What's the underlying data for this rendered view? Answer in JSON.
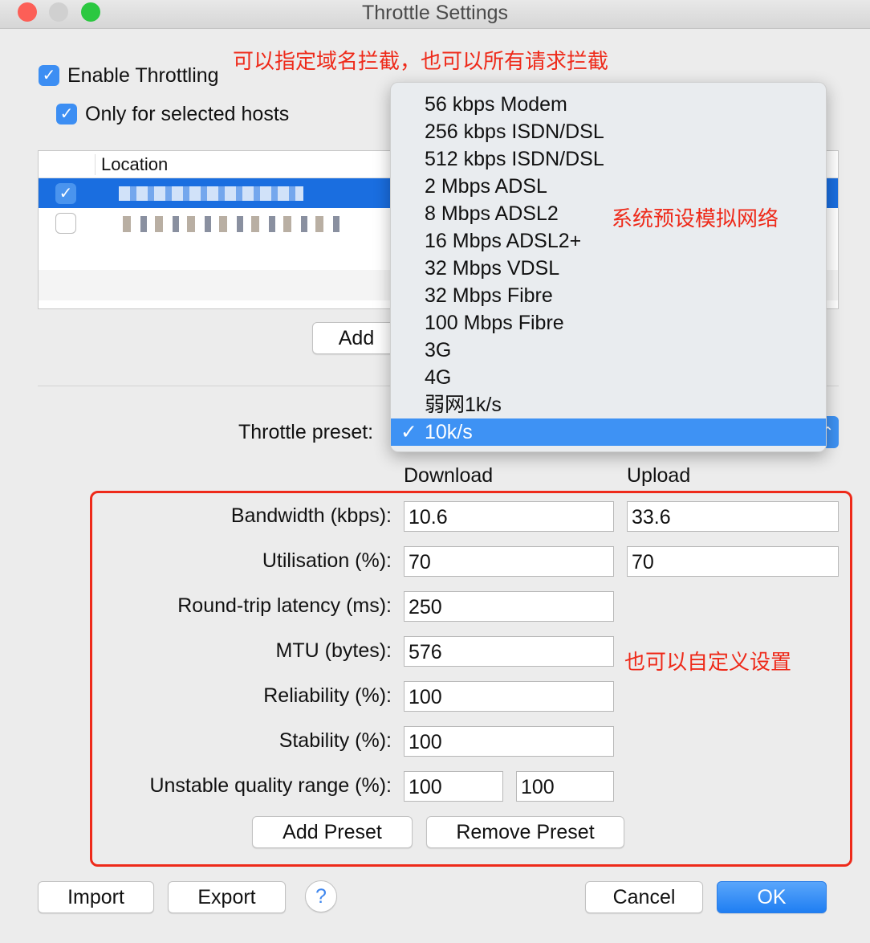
{
  "window": {
    "title": "Throttle Settings"
  },
  "enable_throttling": {
    "label": "Enable Throttling",
    "checked": true
  },
  "only_selected_hosts": {
    "label": "Only for selected hosts",
    "checked": true
  },
  "annotations": {
    "top": "可以指定域名拦截，也可以所有请求拦截",
    "presets": "系统预设模拟网络",
    "custom": "也可以自定义设置"
  },
  "hosts_table": {
    "column": "Location",
    "rows": [
      {
        "checked": true,
        "selected": true
      },
      {
        "checked": false,
        "selected": false
      }
    ]
  },
  "add_host_button": "Add",
  "preset": {
    "label": "Throttle preset:",
    "selected": "10k/s",
    "options": [
      "56 kbps Modem",
      "256 kbps ISDN/DSL",
      "512 kbps ISDN/DSL",
      "2 Mbps ADSL",
      "8 Mbps ADSL2",
      "16 Mbps ADSL2+",
      "32 Mbps VDSL",
      "32 Mbps Fibre",
      "100 Mbps Fibre",
      "3G",
      "4G",
      "弱网1k/s",
      "10k/s"
    ]
  },
  "columns": {
    "download": "Download",
    "upload": "Upload"
  },
  "fields": [
    {
      "label": "Bandwidth (kbps):",
      "download": "10.6",
      "upload": "33.6"
    },
    {
      "label": "Utilisation (%):",
      "download": "70",
      "upload": "70"
    },
    {
      "label": "Round-trip latency (ms):",
      "download": "250"
    },
    {
      "label": "MTU (bytes):",
      "download": "576"
    },
    {
      "label": "Reliability (%):",
      "download": "100"
    },
    {
      "label": "Stability (%):",
      "download": "100"
    },
    {
      "label": "Unstable quality range (%):",
      "download": "100",
      "upload": "100"
    }
  ],
  "buttons": {
    "add_preset": "Add Preset",
    "remove_preset": "Remove Preset",
    "import": "Import",
    "export": "Export",
    "help": "?",
    "cancel": "Cancel",
    "ok": "OK"
  },
  "colors": {
    "accent": "#3e92f4",
    "annotation": "#ee2a1a",
    "selection": "#1a6ee0"
  }
}
